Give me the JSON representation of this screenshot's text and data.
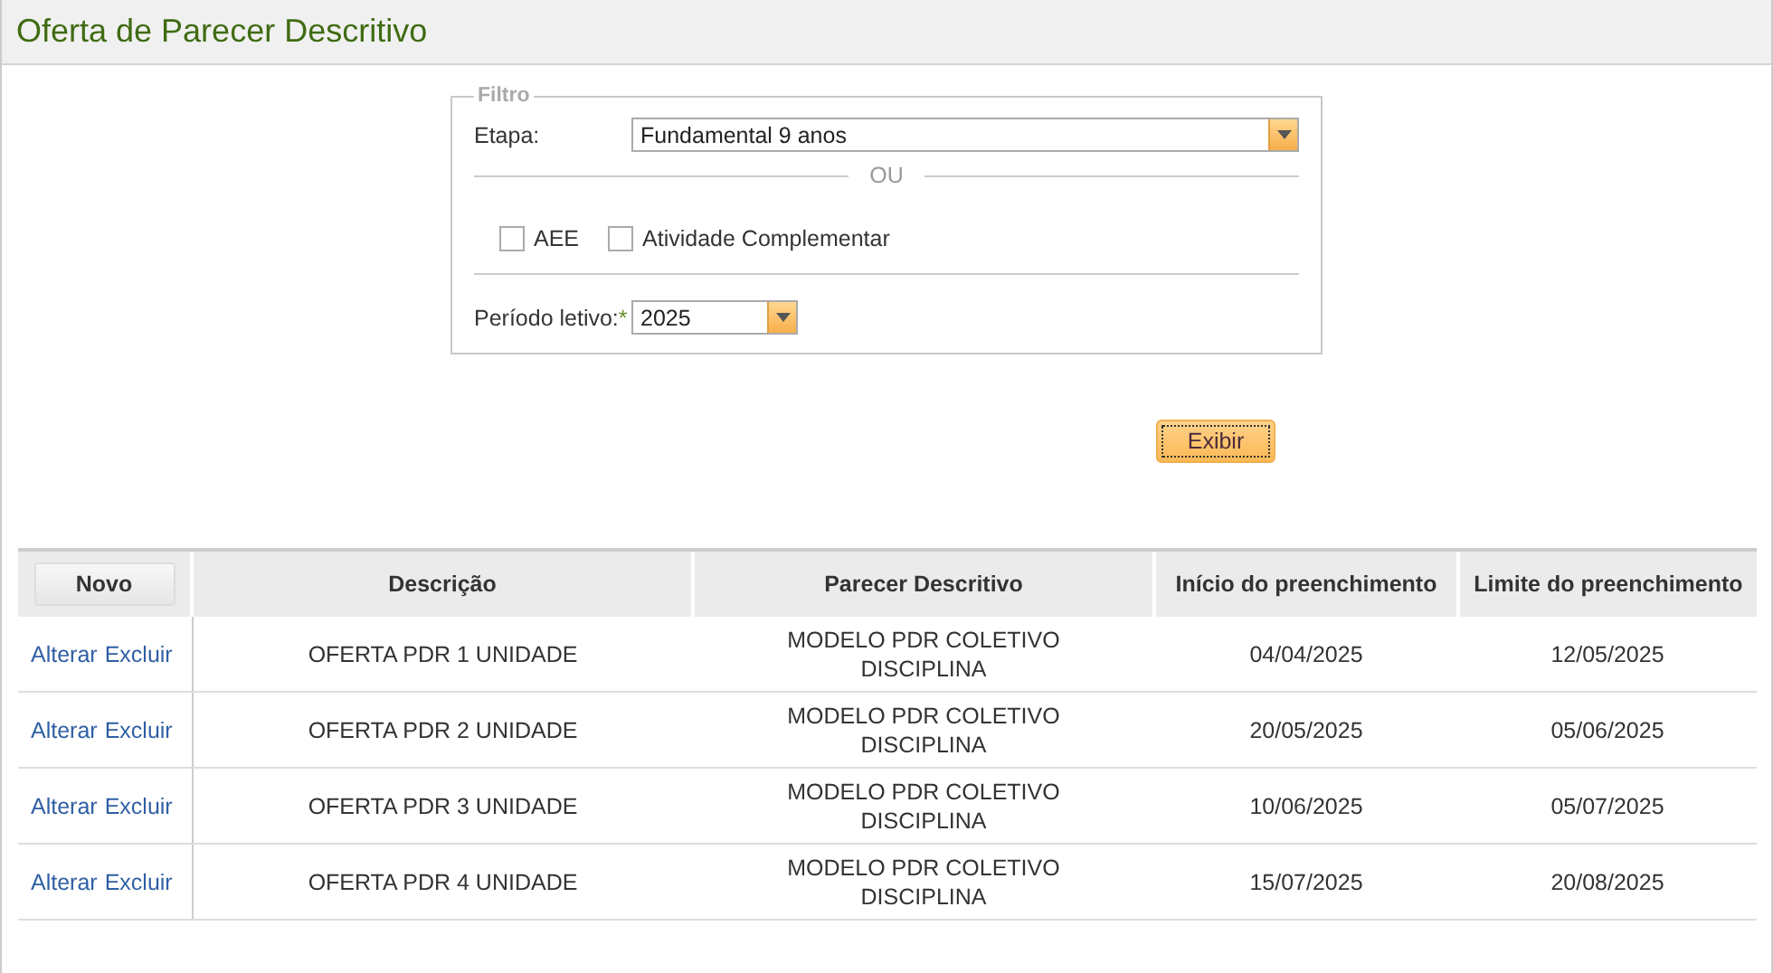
{
  "page_title": "Oferta de Parecer Descritivo",
  "filter": {
    "legend": "Filtro",
    "etapa_label": "Etapa:",
    "etapa_value": "Fundamental 9 anos",
    "separator": "OU",
    "checkboxes": [
      {
        "label": "AEE",
        "checked": false
      },
      {
        "label": "Atividade Complementar",
        "checked": false
      }
    ],
    "periodo_label": "Período letivo:",
    "required_mark": "*",
    "periodo_value": "2025"
  },
  "show_button": "Exibir",
  "table": {
    "new_button": "Novo",
    "columns": [
      "Descrição",
      "Parecer Descritivo",
      "Início do preenchimento",
      "Limite do preenchimento"
    ],
    "rows": [
      {
        "actions": [
          "Alterar",
          "Excluir"
        ],
        "cells": [
          "OFERTA PDR 1 UNIDADE",
          "MODELO PDR COLETIVO DISCIPLINA",
          "04/04/2025",
          "12/05/2025"
        ]
      },
      {
        "actions": [
          "Alterar",
          "Excluir"
        ],
        "cells": [
          "OFERTA PDR 2 UNIDADE",
          "MODELO PDR COLETIVO DISCIPLINA",
          "20/05/2025",
          "05/06/2025"
        ]
      },
      {
        "actions": [
          "Alterar",
          "Excluir"
        ],
        "cells": [
          "OFERTA PDR 3 UNIDADE",
          "MODELO PDR COLETIVO DISCIPLINA",
          "10/06/2025",
          "05/07/2025"
        ]
      },
      {
        "actions": [
          "Alterar",
          "Excluir"
        ],
        "cells": [
          "OFERTA PDR 4 UNIDADE",
          "MODELO PDR COLETIVO DISCIPLINA",
          "15/07/2025",
          "20/08/2025"
        ]
      }
    ]
  }
}
